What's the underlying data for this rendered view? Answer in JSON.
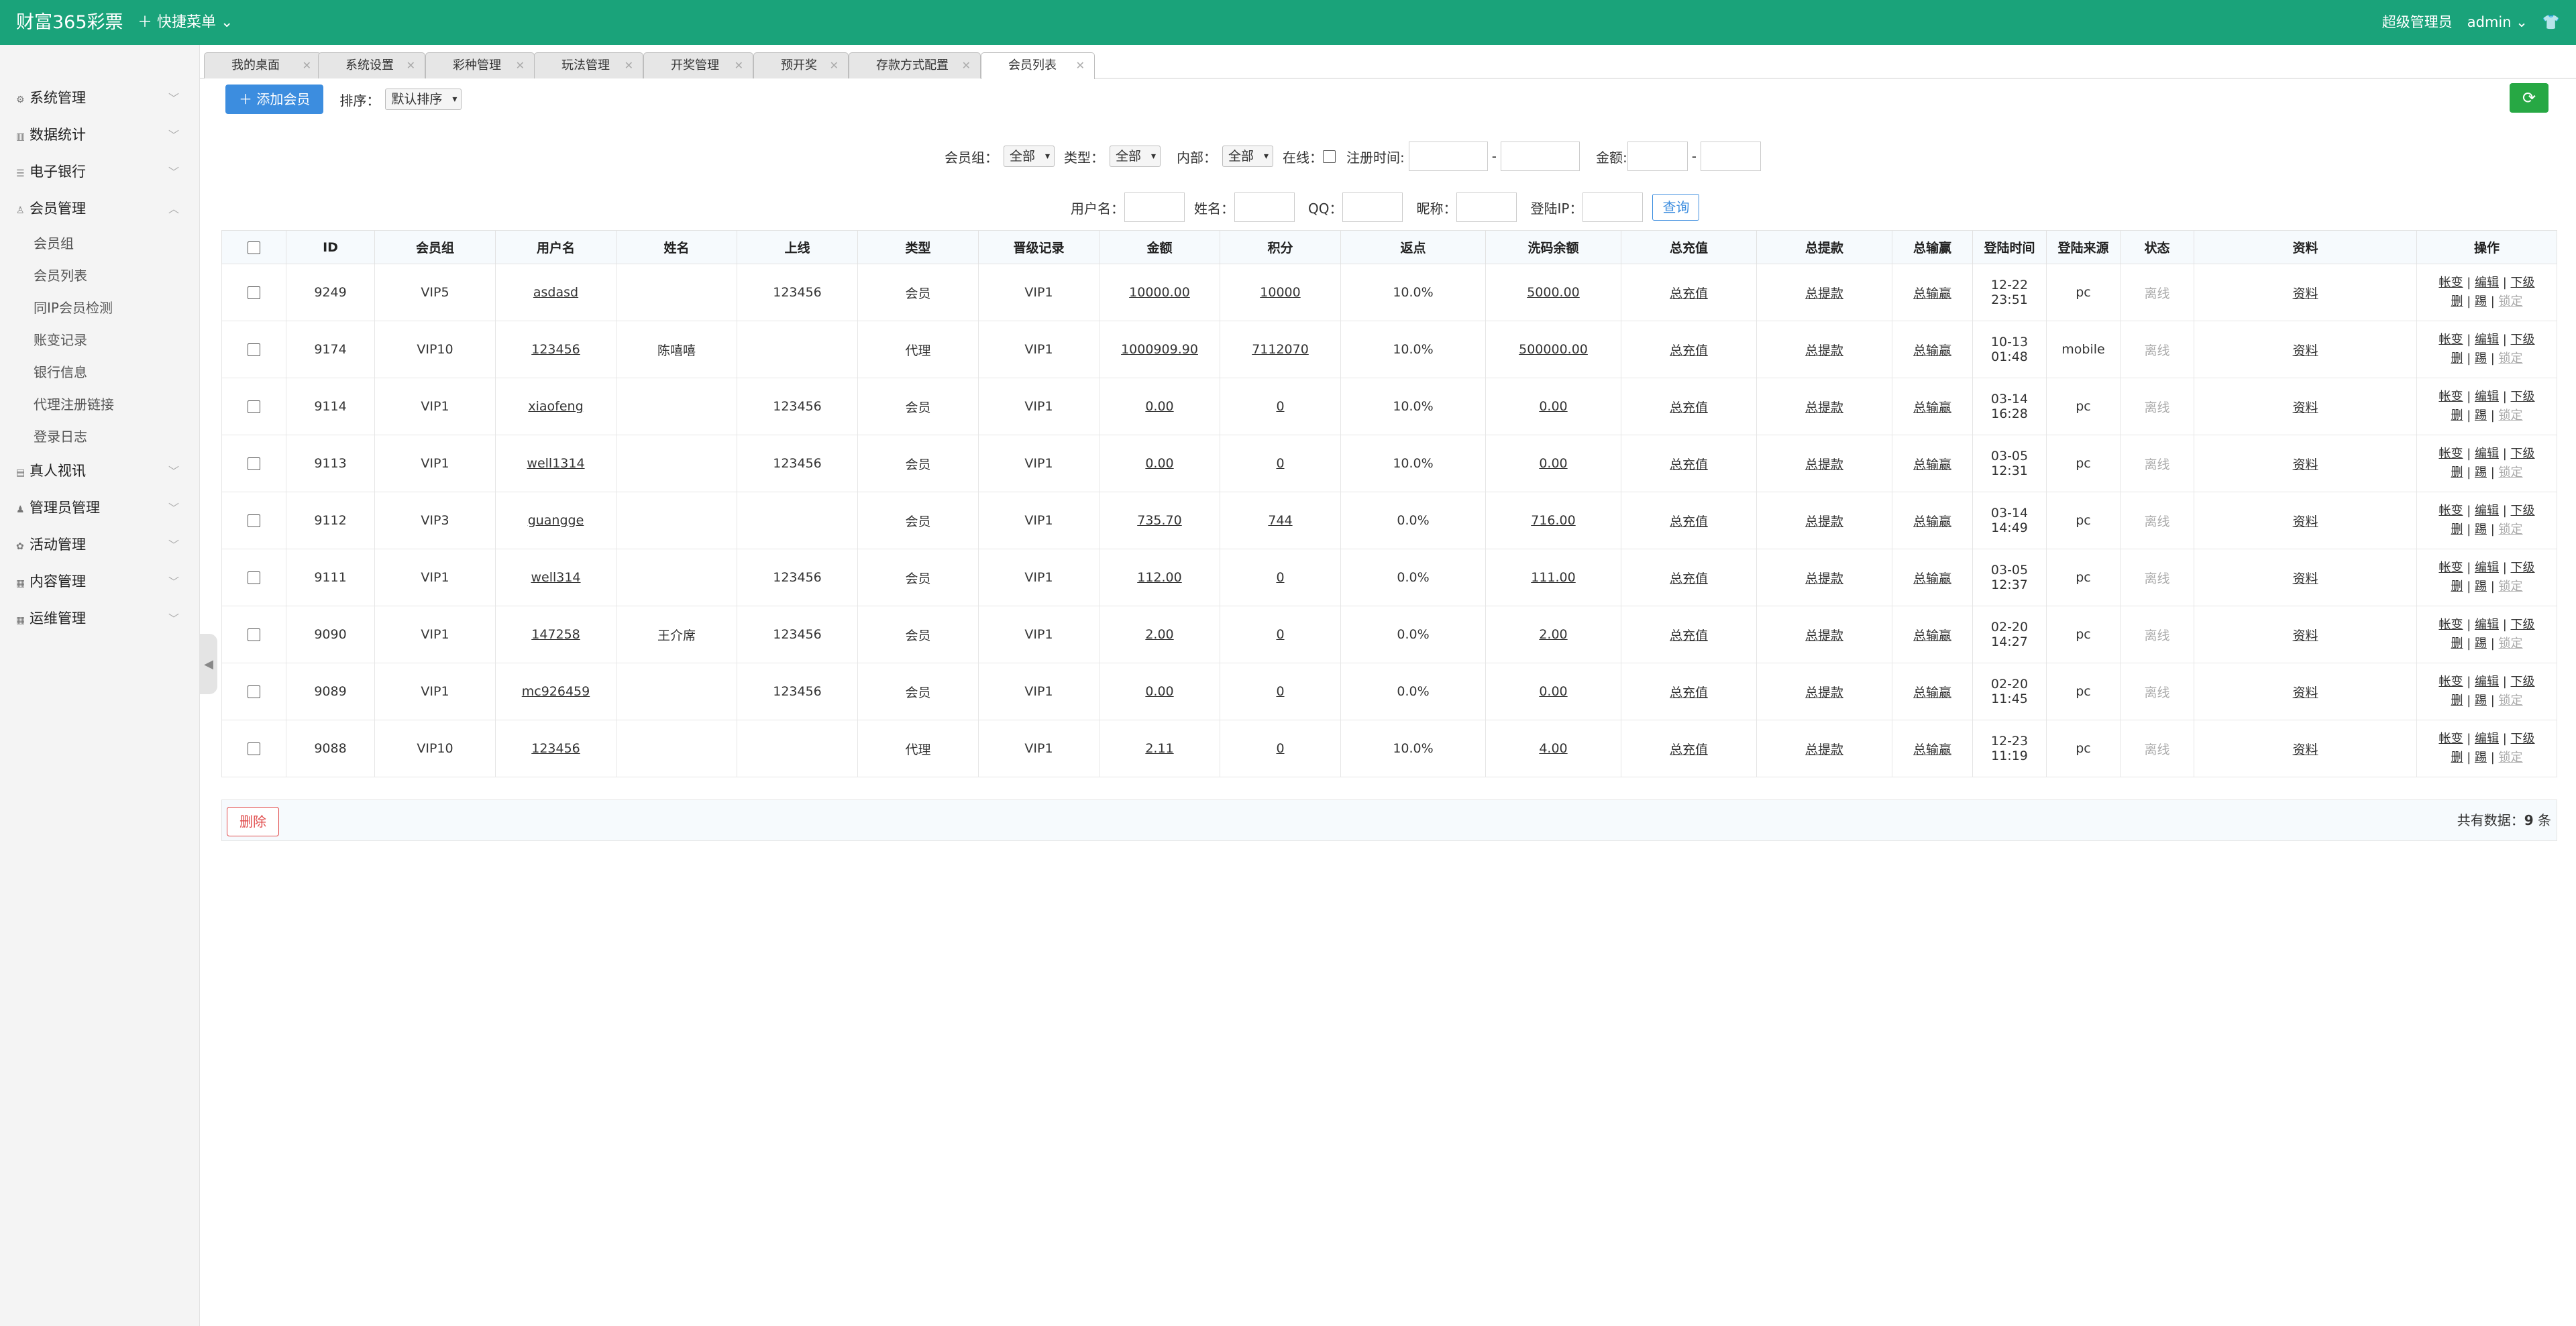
{
  "header": {
    "logo": "财富365彩票",
    "quick_menu": "快捷菜单",
    "role": "超级管理员",
    "user": "admin"
  },
  "sidebar": {
    "items": [
      {
        "label": "系统管理"
      },
      {
        "label": "数据统计"
      },
      {
        "label": "电子银行"
      },
      {
        "label": "会员管理"
      }
    ],
    "sub_items": [
      "会员组",
      "会员列表",
      "同IP会员检测",
      "账变记录",
      "银行信息",
      "代理注册链接",
      "登录日志"
    ],
    "items_after": [
      {
        "label": "真人视讯"
      },
      {
        "label": "管理员管理"
      },
      {
        "label": "活动管理"
      },
      {
        "label": "内容管理"
      },
      {
        "label": "运维管理"
      }
    ]
  },
  "tabs": [
    "我的桌面",
    "系统设置",
    "彩种管理",
    "玩法管理",
    "开奖管理",
    "预开奖",
    "存款方式配置",
    "会员列表"
  ],
  "toolbar": {
    "add_label": "添加会员",
    "sort_label": "排序：",
    "sort_value": "默认排序"
  },
  "filters": {
    "group_label": "会员组：",
    "group_value": "全部",
    "type_label": "类型：",
    "type_value": "全部",
    "internal_label": "内部：",
    "internal_value": "全部",
    "online_label": "在线：",
    "regtime_label": "注册时间:",
    "dash": "-",
    "amount_label": "金额:",
    "username_label": "用户名：",
    "name_label": "姓名：",
    "qq_label": "QQ：",
    "nick_label": "昵称：",
    "ip_label": "登陆IP：",
    "query_label": "查询"
  },
  "table": {
    "headers": [
      "ID",
      "会员组",
      "用户名",
      "姓名",
      "上线",
      "类型",
      "晋级记录",
      "金额",
      "积分",
      "返点",
      "洗码余额",
      "总充值",
      "总提款",
      "总输赢",
      "登陆时间",
      "登陆来源",
      "状态",
      "资料",
      "操作"
    ],
    "rows": [
      [
        "9249",
        "VIP5",
        "asdasd",
        "",
        "123456",
        "会员",
        "VIP1",
        "10000.00",
        "10000",
        "10.0%",
        "5000.00",
        "总充值",
        "总提款",
        "总输赢",
        "12-22 23:51",
        "pc",
        "离线",
        "资料"
      ],
      [
        "9174",
        "VIP10",
        "123456",
        "陈嘻嘻",
        "",
        "代理",
        "VIP1",
        "1000909.90",
        "7112070",
        "10.0%",
        "500000.00",
        "总充值",
        "总提款",
        "总输赢",
        "10-13 01:48",
        "mobile",
        "离线",
        "资料"
      ],
      [
        "9114",
        "VIP1",
        "xiaofeng",
        "",
        "123456",
        "会员",
        "VIP1",
        "0.00",
        "0",
        "10.0%",
        "0.00",
        "总充值",
        "总提款",
        "总输赢",
        "03-14 16:28",
        "pc",
        "离线",
        "资料"
      ],
      [
        "9113",
        "VIP1",
        "well1314",
        "",
        "123456",
        "会员",
        "VIP1",
        "0.00",
        "0",
        "10.0%",
        "0.00",
        "总充值",
        "总提款",
        "总输赢",
        "03-05 12:31",
        "pc",
        "离线",
        "资料"
      ],
      [
        "9112",
        "VIP3",
        "guangge",
        "",
        "",
        "会员",
        "VIP1",
        "735.70",
        "744",
        "0.0%",
        "716.00",
        "总充值",
        "总提款",
        "总输赢",
        "03-14 14:49",
        "pc",
        "离线",
        "资料"
      ],
      [
        "9111",
        "VIP1",
        "well314",
        "",
        "123456",
        "会员",
        "VIP1",
        "112.00",
        "0",
        "0.0%",
        "111.00",
        "总充值",
        "总提款",
        "总输赢",
        "03-05 12:37",
        "pc",
        "离线",
        "资料"
      ],
      [
        "9090",
        "VIP1",
        "147258",
        "王介席",
        "123456",
        "会员",
        "VIP1",
        "2.00",
        "0",
        "0.0%",
        "2.00",
        "总充值",
        "总提款",
        "总输赢",
        "02-20 14:27",
        "pc",
        "离线",
        "资料"
      ],
      [
        "9089",
        "VIP1",
        "mc926459",
        "",
        "123456",
        "会员",
        "VIP1",
        "0.00",
        "0",
        "0.0%",
        "0.00",
        "总充值",
        "总提款",
        "总输赢",
        "02-20 11:45",
        "pc",
        "离线",
        "资料"
      ],
      [
        "9088",
        "VIP10",
        "123456",
        "",
        "",
        "代理",
        "VIP1",
        "2.11",
        "0",
        "10.0%",
        "4.00",
        "总充值",
        "总提款",
        "总输赢",
        "12-23 11:19",
        "pc",
        "离线",
        "资料"
      ]
    ],
    "ops": {
      "line1": [
        "帐变",
        "编辑",
        "下级"
      ],
      "line2": [
        "删",
        "踢",
        "锁定"
      ],
      "sep": "|"
    }
  },
  "footer": {
    "delete_label": "删除",
    "total_label": "共有数据：",
    "total_count": "9",
    "total_unit": "条"
  }
}
